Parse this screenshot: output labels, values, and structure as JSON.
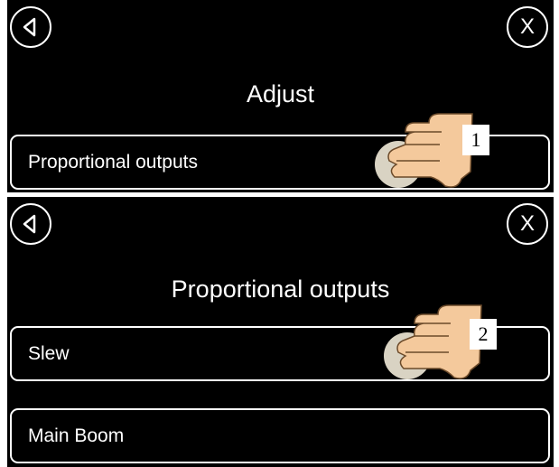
{
  "screen1": {
    "title": "Adjust",
    "back_icon": "chevron-left-icon",
    "close_label": "X",
    "items": [
      {
        "label": "Proportional outputs"
      }
    ],
    "step_marker": "1"
  },
  "screen2": {
    "title": "Proportional outputs",
    "back_icon": "chevron-left-icon",
    "close_label": "X",
    "items": [
      {
        "label": "Slew"
      },
      {
        "label": "Main Boom"
      }
    ],
    "step_marker": "2"
  },
  "colors": {
    "background": "#000000",
    "foreground": "#ffffff",
    "hand": "#f4c99c",
    "touch_dot": "#d9d3c3"
  }
}
